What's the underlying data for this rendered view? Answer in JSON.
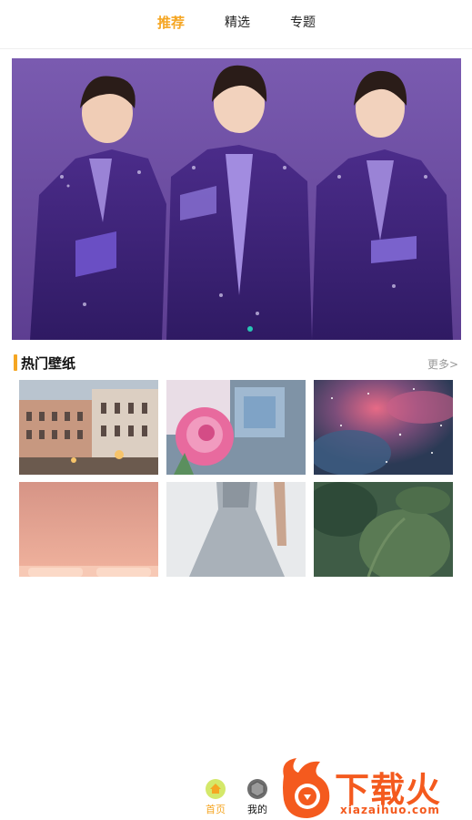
{
  "tabs": [
    {
      "label": "推荐",
      "active": true
    },
    {
      "label": "精选",
      "active": false
    },
    {
      "label": "专题",
      "active": false
    }
  ],
  "banner": {
    "subject": "three boys in purple sequined suits",
    "indicator_dot_color": "#28c5b5"
  },
  "section": {
    "title": "热门壁纸",
    "more_label": "更多>"
  },
  "wallpapers": [
    {
      "subject": "venice buildings at dusk"
    },
    {
      "subject": "pink rose and glass cube"
    },
    {
      "subject": "pink nebula in starry sky"
    },
    {
      "subject": "peach sofa"
    },
    {
      "subject": "grey tulle dress"
    },
    {
      "subject": "green leaves"
    }
  ],
  "bottom_nav": [
    {
      "label": "首页",
      "icon": "home-icon",
      "active": true
    },
    {
      "label": "我的",
      "icon": "user-icon",
      "active": false
    }
  ],
  "watermark": {
    "text": "下载火",
    "domain": "xiazaihuo.com"
  },
  "colors": {
    "accent": "#f5a623",
    "watermark": "#f45a1e"
  }
}
